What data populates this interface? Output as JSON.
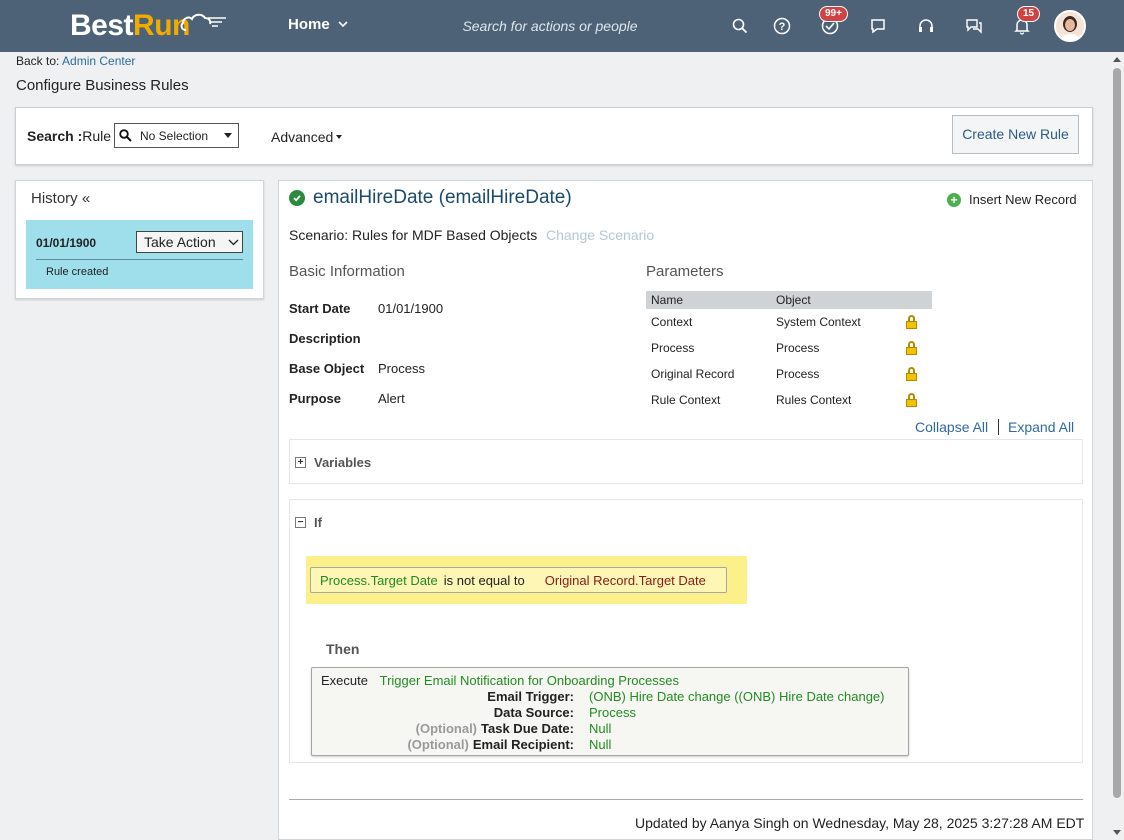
{
  "header": {
    "logo_best": "Best",
    "logo_run": "Run",
    "home_label": "Home",
    "search_placeholder": "Search for actions or people",
    "todo_badge": "99+",
    "notifications_badge": "15"
  },
  "breadcrumb": {
    "prefix": "Back to:",
    "link": "Admin Center"
  },
  "page_title": "Configure Business Rules",
  "search": {
    "label": "Search :",
    "sub_label": "Rule",
    "select_value": "No Selection",
    "advanced_label": "Advanced",
    "create_button": "Create New Rule"
  },
  "history": {
    "title": "History «",
    "entries": [
      {
        "date": "01/01/1900",
        "action_label": "Take Action",
        "description": "Rule created"
      }
    ]
  },
  "rule": {
    "title": "emailHireDate (emailHireDate)",
    "insert_label": "Insert New Record",
    "scenario_label": "Scenario:",
    "scenario_value": "Rules for MDF Based Objects",
    "change_scenario": "Change Scenario",
    "basic_info_title": "Basic Information",
    "fields": [
      {
        "label": "Start Date",
        "value": "01/01/1900"
      },
      {
        "label": "Description",
        "value": ""
      },
      {
        "label": "Base Object",
        "value": "Process"
      },
      {
        "label": "Purpose",
        "value": "Alert"
      }
    ],
    "parameters_title": "Parameters",
    "parameters_headers": [
      "Name",
      "Object"
    ],
    "parameters": [
      {
        "name": "Context",
        "object": "System Context"
      },
      {
        "name": "Process",
        "object": "Process"
      },
      {
        "name": "Original Record",
        "object": "Process"
      },
      {
        "name": "Rule Context",
        "object": "Rules Context"
      }
    ],
    "collapse_all": "Collapse All",
    "expand_all": "Expand All",
    "variables_label": "Variables",
    "if_label": "If",
    "condition": {
      "left": "Process.Target Date",
      "operator": "is not equal to",
      "right": "Original Record.Target Date"
    },
    "then_label": "Then",
    "execute": {
      "keyword": "Execute",
      "function": "Trigger Email Notification for Onboarding Processes",
      "optional_label": "(Optional)",
      "params": [
        {
          "optional": false,
          "label": "Email Trigger:",
          "value": "(ONB) Hire Date change ((ONB) Hire Date change)"
        },
        {
          "optional": false,
          "label": "Data Source:",
          "value": "Process"
        },
        {
          "optional": true,
          "label": "Task Due Date:",
          "value": "Null"
        },
        {
          "optional": true,
          "label": "Email Recipient:",
          "value": "Null"
        }
      ]
    },
    "updated": "Updated by Aanya Singh on Wednesday, May 28, 2025 3:27:28 AM EDT"
  },
  "colors": {
    "header_bg": "#4d6277",
    "accent_link": "#2e6aa1",
    "history_highlight": "#9fdfec",
    "condition_highlight": "#fbf089",
    "value_green": "#228b22",
    "value_red": "#8b1a1a"
  }
}
